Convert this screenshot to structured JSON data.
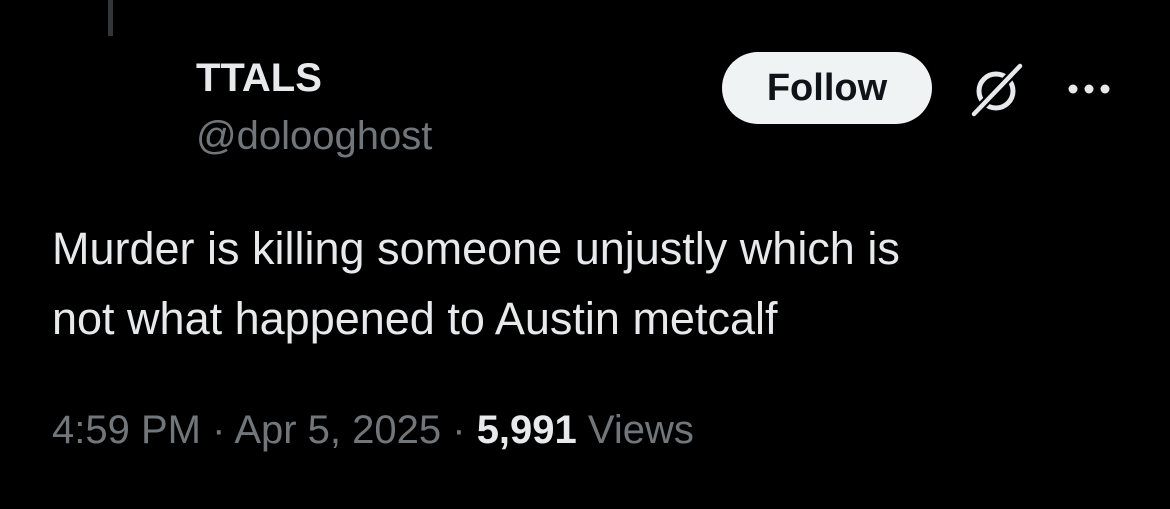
{
  "tweet": {
    "author": {
      "display_name": "TTALS",
      "handle": "@dolooghost"
    },
    "actions": {
      "follow_label": "Follow",
      "grok_icon": "grok-slash-circle-icon",
      "more_icon": "more-horizontal-icon"
    },
    "text_line_1": "Murder is killing someone unjustly which is",
    "text_line_2": "not what happened to Austin metcalf",
    "meta": {
      "time": "4:59 PM",
      "separator": " · ",
      "date": "Apr 5, 2025",
      "views_count": "5,991",
      "views_label": "Views"
    }
  },
  "colors": {
    "background": "#000000",
    "primary_text": "#e7e9ea",
    "secondary_text": "#71767b",
    "follow_bg": "#eff3f4",
    "follow_text": "#0f1419"
  }
}
